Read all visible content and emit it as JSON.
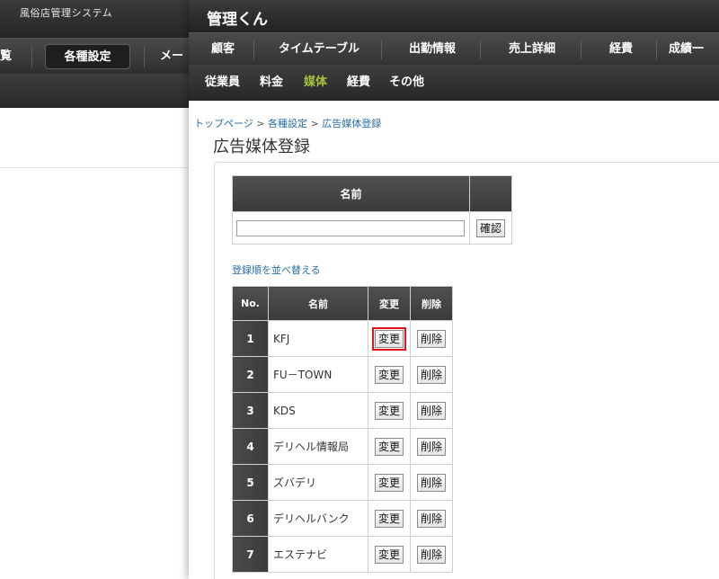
{
  "background_window": {
    "title": "風俗店管理システム",
    "nav_items": [
      "覧",
      "各種設定",
      "メー"
    ],
    "selected_item": "各種設定"
  },
  "app": {
    "title": "管理くん"
  },
  "main_nav": [
    "顧客",
    "タイムテーブル",
    "出勤情報",
    "売上詳細",
    "経費",
    "成績一"
  ],
  "sub_nav": {
    "items": [
      "従業員",
      "料金",
      "媒体",
      "経費",
      "その他"
    ],
    "active": "媒体"
  },
  "breadcrumb": {
    "items": [
      "トップページ",
      "各種設定",
      "広告媒体登録"
    ],
    "separator": ">"
  },
  "page_title": "広告媒体登録",
  "search": {
    "header_name": "名前",
    "input_value": "",
    "confirm_label": "確認"
  },
  "sort_link": "登録順を並べ替える",
  "table": {
    "headers": [
      "No.",
      "名前",
      "変更",
      "削除"
    ],
    "edit_label": "変更",
    "delete_label": "削除",
    "rows": [
      {
        "no": "1",
        "name": "KFJ"
      },
      {
        "no": "2",
        "name": "FU－TOWN"
      },
      {
        "no": "3",
        "name": "KDS"
      },
      {
        "no": "4",
        "name": "デリヘル情報局"
      },
      {
        "no": "5",
        "name": "ズバデリ"
      },
      {
        "no": "6",
        "name": "デリヘルバンク"
      },
      {
        "no": "7",
        "name": "エステナビ"
      }
    ]
  },
  "colors": {
    "accent_active": "#a8c43c",
    "link": "#2a6ea8",
    "highlight": "#e0141a",
    "header_dark": "#3a3a3a"
  }
}
